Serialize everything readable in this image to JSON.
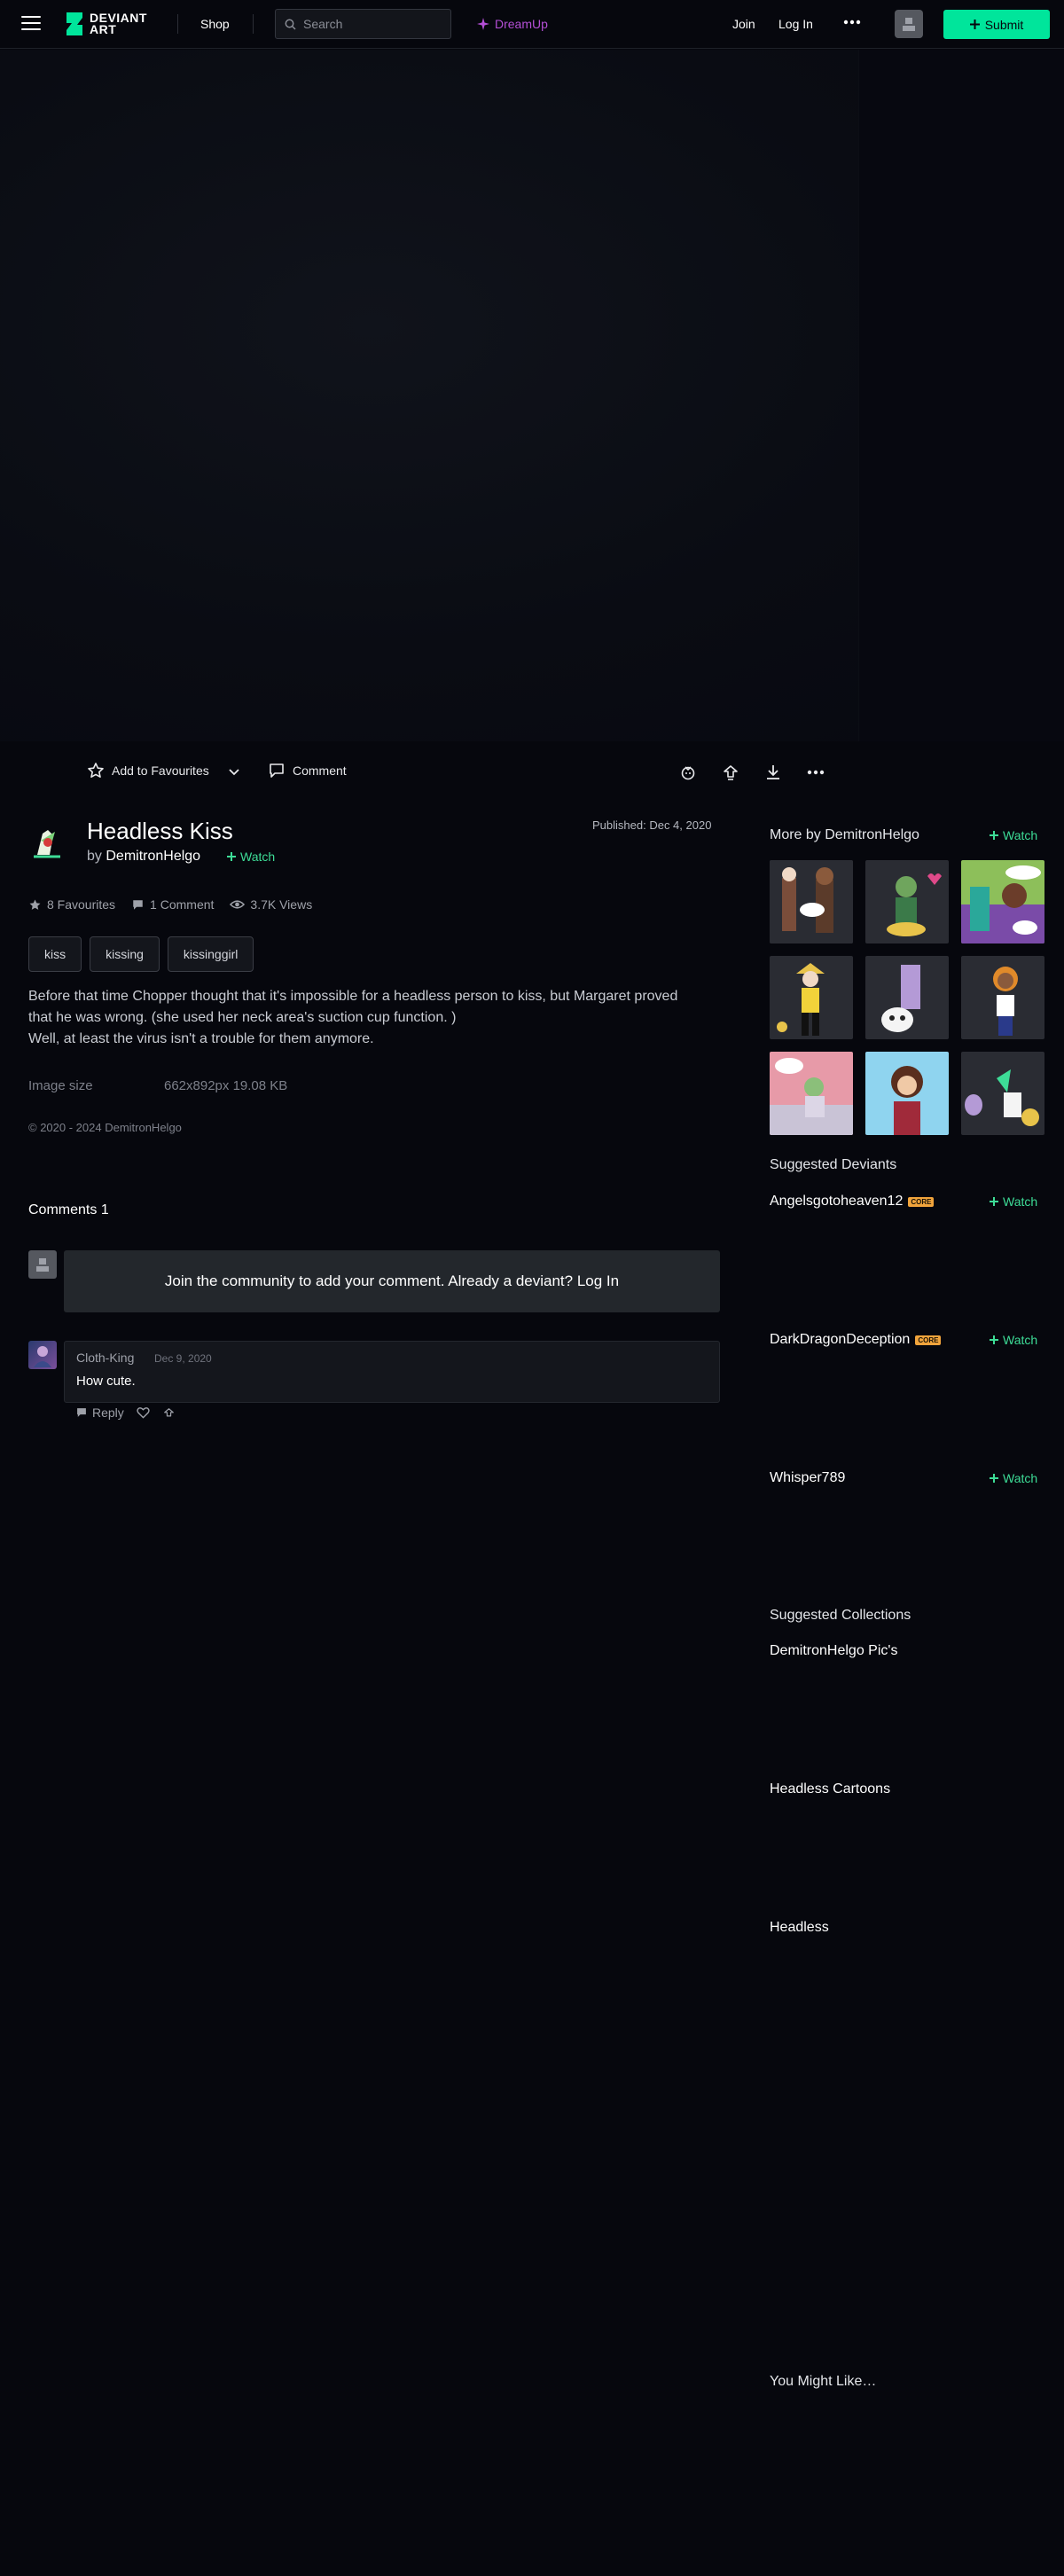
{
  "topbar": {
    "logo_line1": "DEVIANT",
    "logo_line2": "ART",
    "shop": "Shop",
    "search_placeholder": "Search",
    "dreamup": "DreamUp",
    "join": "Join",
    "login": "Log In",
    "submit": "Submit",
    "accent": "#00e59b"
  },
  "actions": {
    "add_to_favourites": "Add to Favourites",
    "comment": "Comment"
  },
  "deviation": {
    "title": "Headless Kiss",
    "by": "by",
    "author": "DemitronHelgo",
    "watch": "Watch",
    "published": "Published: Dec 4, 2020",
    "stats": {
      "favourites": "8 Favourites",
      "comments": "1 Comment",
      "views": "3.7K Views"
    },
    "tags": [
      "kiss",
      "kissing",
      "kissinggirl"
    ],
    "description": [
      "Before that time Chopper thought that it's impossible for a headless person to kiss, but Margaret proved",
      "that he was wrong. (she used her neck area's suction cup function. )",
      "Well, at least the virus isn't a trouble for them anymore."
    ],
    "image_size_label": "Image size",
    "image_size_value": "662x892px 19.08 KB",
    "copyright": "© 2020 - 2024 DemitronHelgo"
  },
  "comments": {
    "title": "Comments",
    "count": "1",
    "join_prompt": "Join the community to add your comment. Already a deviant? Log In",
    "items": [
      {
        "user": "Cloth-King",
        "date": "Dec 9, 2020",
        "text": "How cute.",
        "reply": "Reply"
      }
    ]
  },
  "sidebar": {
    "more_by": "More by DemitronHelgo",
    "watch": "Watch",
    "suggested_deviants_title": "Suggested Deviants",
    "deviants": [
      {
        "name": "Angelsgotoheaven12",
        "badge": "CORE",
        "watch": "Watch"
      },
      {
        "name": "DarkDragonDeception",
        "badge": "CORE",
        "watch": "Watch"
      },
      {
        "name": "Whisper789",
        "badge": "",
        "watch": "Watch"
      }
    ],
    "suggested_collections_title": "Suggested Collections",
    "collections": [
      "DemitronHelgo Pic's",
      "Headless Cartoons",
      "Headless"
    ],
    "you_might_like": "You Might Like…"
  }
}
